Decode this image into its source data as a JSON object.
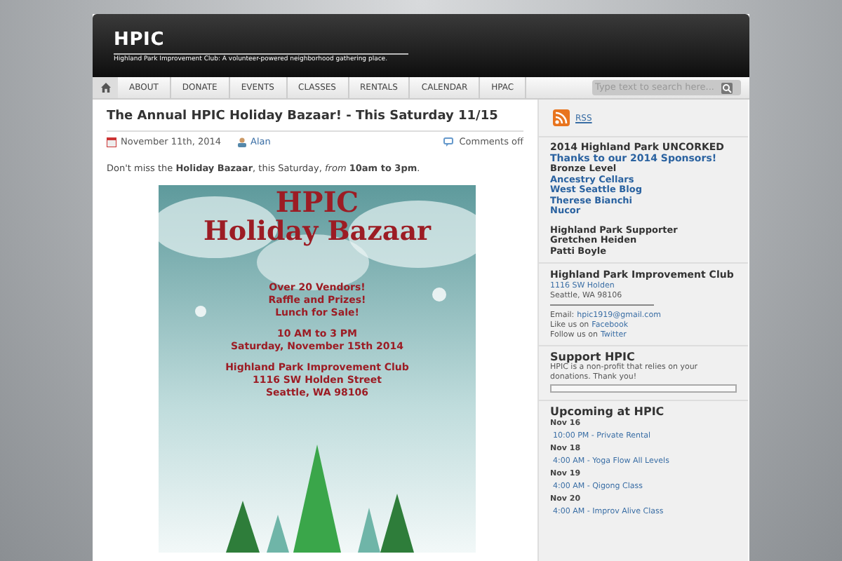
{
  "site": {
    "title": "HPIC",
    "tagline": "Highland Park Improvement Club: A volunteer-powered neighborhood gathering place."
  },
  "nav": {
    "items": [
      {
        "label": "ABOUT",
        "selected": false
      },
      {
        "label": "DONATE",
        "selected": false
      },
      {
        "label": "EVENTS",
        "selected": false
      },
      {
        "label": "CLASSES",
        "selected": false
      },
      {
        "label": "RENTALS",
        "selected": false
      },
      {
        "label": "CALENDAR",
        "selected": false
      },
      {
        "label": "HPAC",
        "selected": false
      }
    ],
    "search": {
      "placeholder": "Type text to search here..."
    }
  },
  "post": {
    "title": "The Annual HPIC Holiday Bazaar! - This Saturday 11/15",
    "date": "November 11th, 2014",
    "author": "Alan",
    "comments": "Comments off",
    "intro": "Don't miss the **Holiday Bazaar**, this Saturday, *from* **10am to 3pm**.",
    "flyer": {
      "heading": "HPIC",
      "title": "Holiday Bazaar",
      "blocks": [
        [
          "Over 20 Vendors!",
          "Raffle and Prizes!",
          "Lunch for Sale!"
        ],
        [
          "10 AM to 3 PM",
          "Saturday, November 15th 2014"
        ],
        [
          "Highland Park Improvement Club",
          "1116 SW Holden Street",
          "Seattle, WA 98106"
        ]
      ]
    }
  },
  "sidebar": {
    "rss": "RSS",
    "sponsors": {
      "title": "2014 Highland Park UNCORKED",
      "subtitle": "Thanks to our 2014 Sponsors!",
      "groups": [
        {
          "level": "Bronze Level",
          "names": [
            "Ancestry Cellars",
            "West Seattle Blog",
            "Therese Bianchi",
            "Nucor"
          ],
          "linked": true
        },
        {
          "level": "Highland Park Supporter",
          "names": [
            "Gretchen Heiden",
            "Patti Boyle"
          ],
          "linked": false
        }
      ]
    },
    "club": {
      "title": "Highland Park Improvement Club",
      "address_link": "1116 SW Holden",
      "city": "Seattle, WA 98106",
      "email_label": "Email:",
      "email": "hpic1919@gmail.com",
      "facebook_label": "Like us on",
      "facebook": "Facebook",
      "twitter_label": "Follow us on",
      "twitter": "Twitter"
    },
    "support": {
      "title": "Support HPIC",
      "text": "HPIC is a non-profit that relies on your donations.  Thank you!"
    },
    "upcoming": {
      "title": "Upcoming at HPIC",
      "days": [
        {
          "date": "Nov 16",
          "event": "10:00 PM - Private Rental"
        },
        {
          "date": "Nov 18",
          "event": "4:00 AM - Yoga Flow All Levels"
        },
        {
          "date": "Nov 19",
          "event": "4:00 AM - Qigong Class"
        },
        {
          "date": "Nov 20",
          "event": "4:00 AM - Improv Alive Class"
        }
      ]
    }
  }
}
